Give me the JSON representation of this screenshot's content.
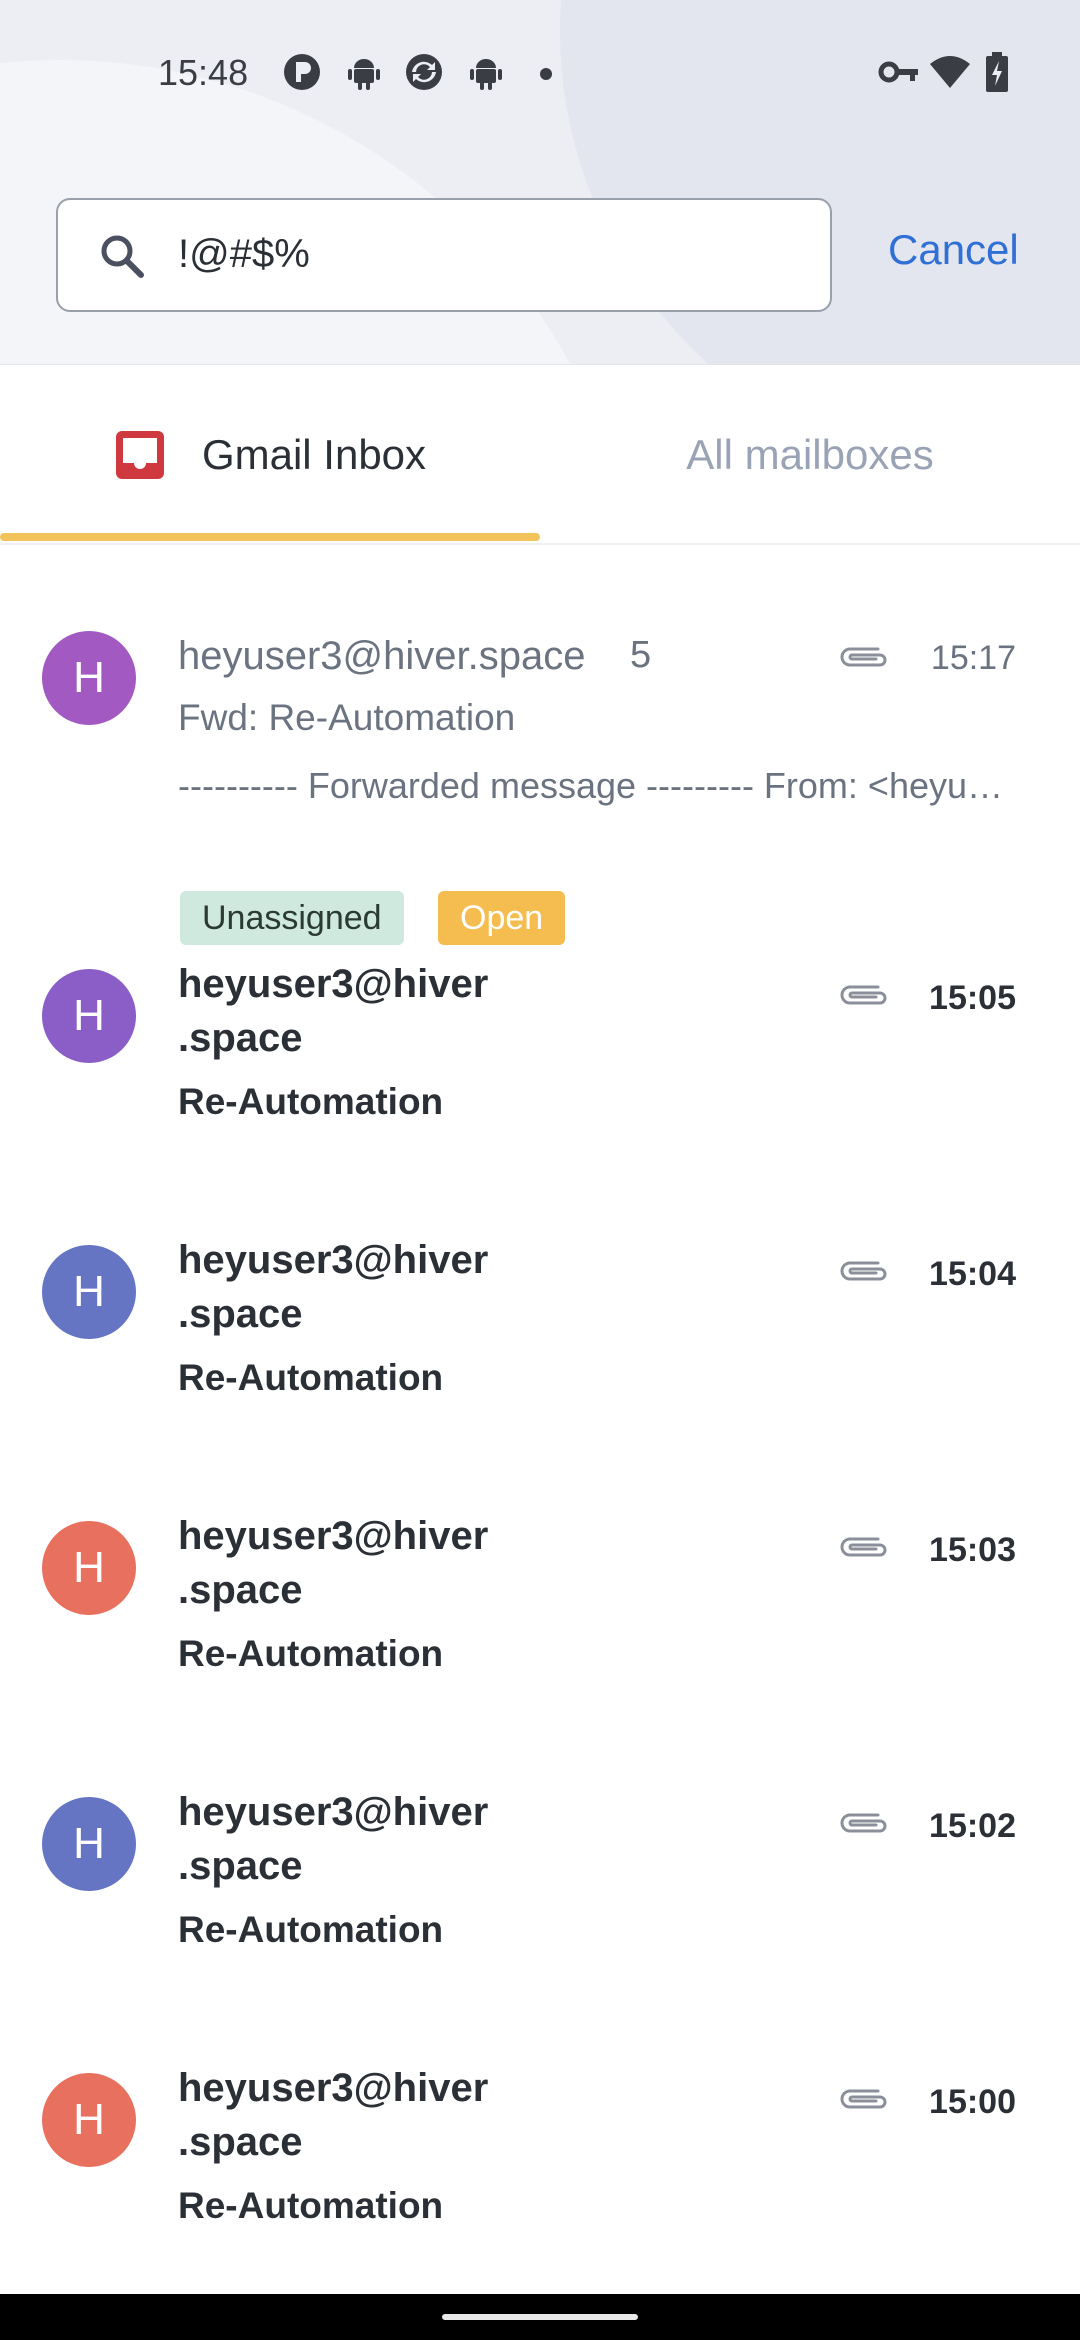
{
  "status_bar": {
    "time": "15:48",
    "icons": [
      "app-p-icon",
      "android-icon",
      "sync-icon",
      "android-icon",
      "dot-icon",
      "vpn-key-icon",
      "wifi-icon",
      "battery-charging-icon"
    ]
  },
  "search": {
    "query": "!@#$%",
    "cancel_label": "Cancel",
    "icon": "search-icon"
  },
  "tabs": [
    {
      "label": "Gmail Inbox",
      "icon": "inbox-icon",
      "icon_color": "#d0383f",
      "active": true
    },
    {
      "label": "All mailboxes",
      "active": false
    }
  ],
  "accent": {
    "tab_underline": "#f2c25b",
    "link": "#2f6fd6"
  },
  "emails": [
    {
      "avatar_letter": "H",
      "avatar_color": "#a259c1",
      "sender": "heyuser3@hiver.space",
      "count": "5",
      "subject": "Fwd: Re-Automation",
      "preview": "---------- Forwarded message --------- From: <heyuser3@hiver.space>",
      "time": "15:17",
      "has_attachment": true,
      "unread": false,
      "tags": [
        "Unassigned",
        "Open"
      ]
    },
    {
      "avatar_letter": "H",
      "avatar_color": "#8a5ec6",
      "sender_line1": "heyuser3@hiver",
      "sender_line2": ".space",
      "subject": "Re-Automation",
      "time": "15:05",
      "has_attachment": true,
      "unread": true
    },
    {
      "avatar_letter": "H",
      "avatar_color": "#6674c4",
      "sender_line1": "heyuser3@hiver",
      "sender_line2": ".space",
      "subject": "Re-Automation",
      "time": "15:04",
      "has_attachment": true,
      "unread": true
    },
    {
      "avatar_letter": "H",
      "avatar_color": "#e8705e",
      "sender_line1": "heyuser3@hiver",
      "sender_line2": ".space",
      "subject": "Re-Automation",
      "time": "15:03",
      "has_attachment": true,
      "unread": true
    },
    {
      "avatar_letter": "H",
      "avatar_color": "#6674c4",
      "sender_line1": "heyuser3@hiver",
      "sender_line2": ".space",
      "subject": "Re-Automation",
      "time": "15:02",
      "has_attachment": true,
      "unread": true
    },
    {
      "avatar_letter": "H",
      "avatar_color": "#e8705e",
      "sender_line1": "heyuser3@hiver",
      "sender_line2": ".space",
      "subject": "Re-Automation",
      "time": "15:00",
      "has_attachment": true,
      "unread": true
    }
  ]
}
